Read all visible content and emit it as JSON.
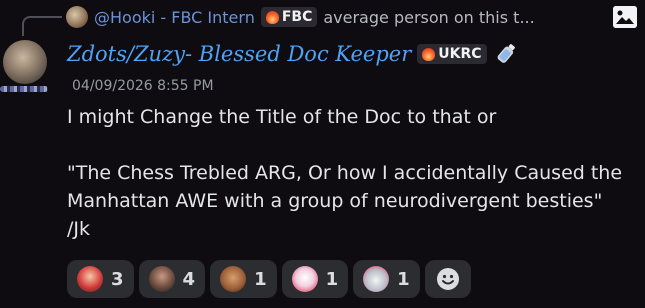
{
  "reply": {
    "author": "@Hooki - FBC Intern",
    "tag": "FBC",
    "preview": "average person on this t..."
  },
  "message": {
    "author": "Zdots/Zuzy- Blessed Doc Keeper",
    "tag": "UKRC",
    "timestamp": "04/09/2026 8:55 PM",
    "lines": [
      "I might Change the Title of the Doc to that or",
      "\"The Chess Trebled ARG, Or how I accidentally Caused the Manhattan AWE with a group of neurodivergent besties\" /Jk"
    ]
  },
  "reactions": [
    {
      "emoji": "red-avatar-emoji",
      "count": "3"
    },
    {
      "emoji": "face-emoji",
      "count": "4"
    },
    {
      "emoji": "brown-face-emoji",
      "count": "1"
    },
    {
      "emoji": "cartoon-face-emoji",
      "count": "1"
    },
    {
      "emoji": "droplet-emoji",
      "count": "1"
    }
  ],
  "icons": {
    "image": "image-icon",
    "bottle": "bottle-icon",
    "add_reaction": "smile-icon"
  },
  "colors": {
    "background": "#0e0c10",
    "author_blue": "#4fa3f7",
    "reply_name": "#6b93d6",
    "reaction_bg": "#2b2d31"
  }
}
